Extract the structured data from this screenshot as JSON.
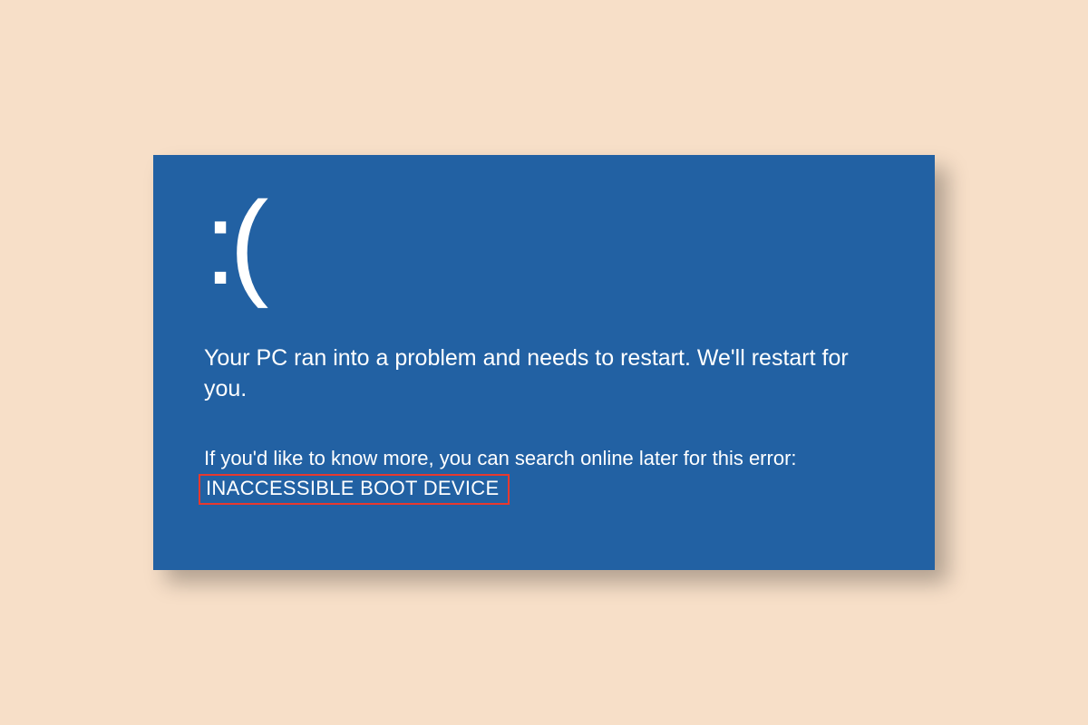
{
  "bsod": {
    "sad_face": ":(",
    "main_message": "Your PC ran into a problem and needs to restart. We'll restart for you.",
    "search_hint": "If you'd like to know more, you can search online later for this error:",
    "error_code": "INACCESSIBLE BOOT DEVICE"
  },
  "colors": {
    "background": "#f7dfc8",
    "bsod_blue": "#2261a3",
    "highlight_border": "#e8392e",
    "text": "#ffffff"
  }
}
